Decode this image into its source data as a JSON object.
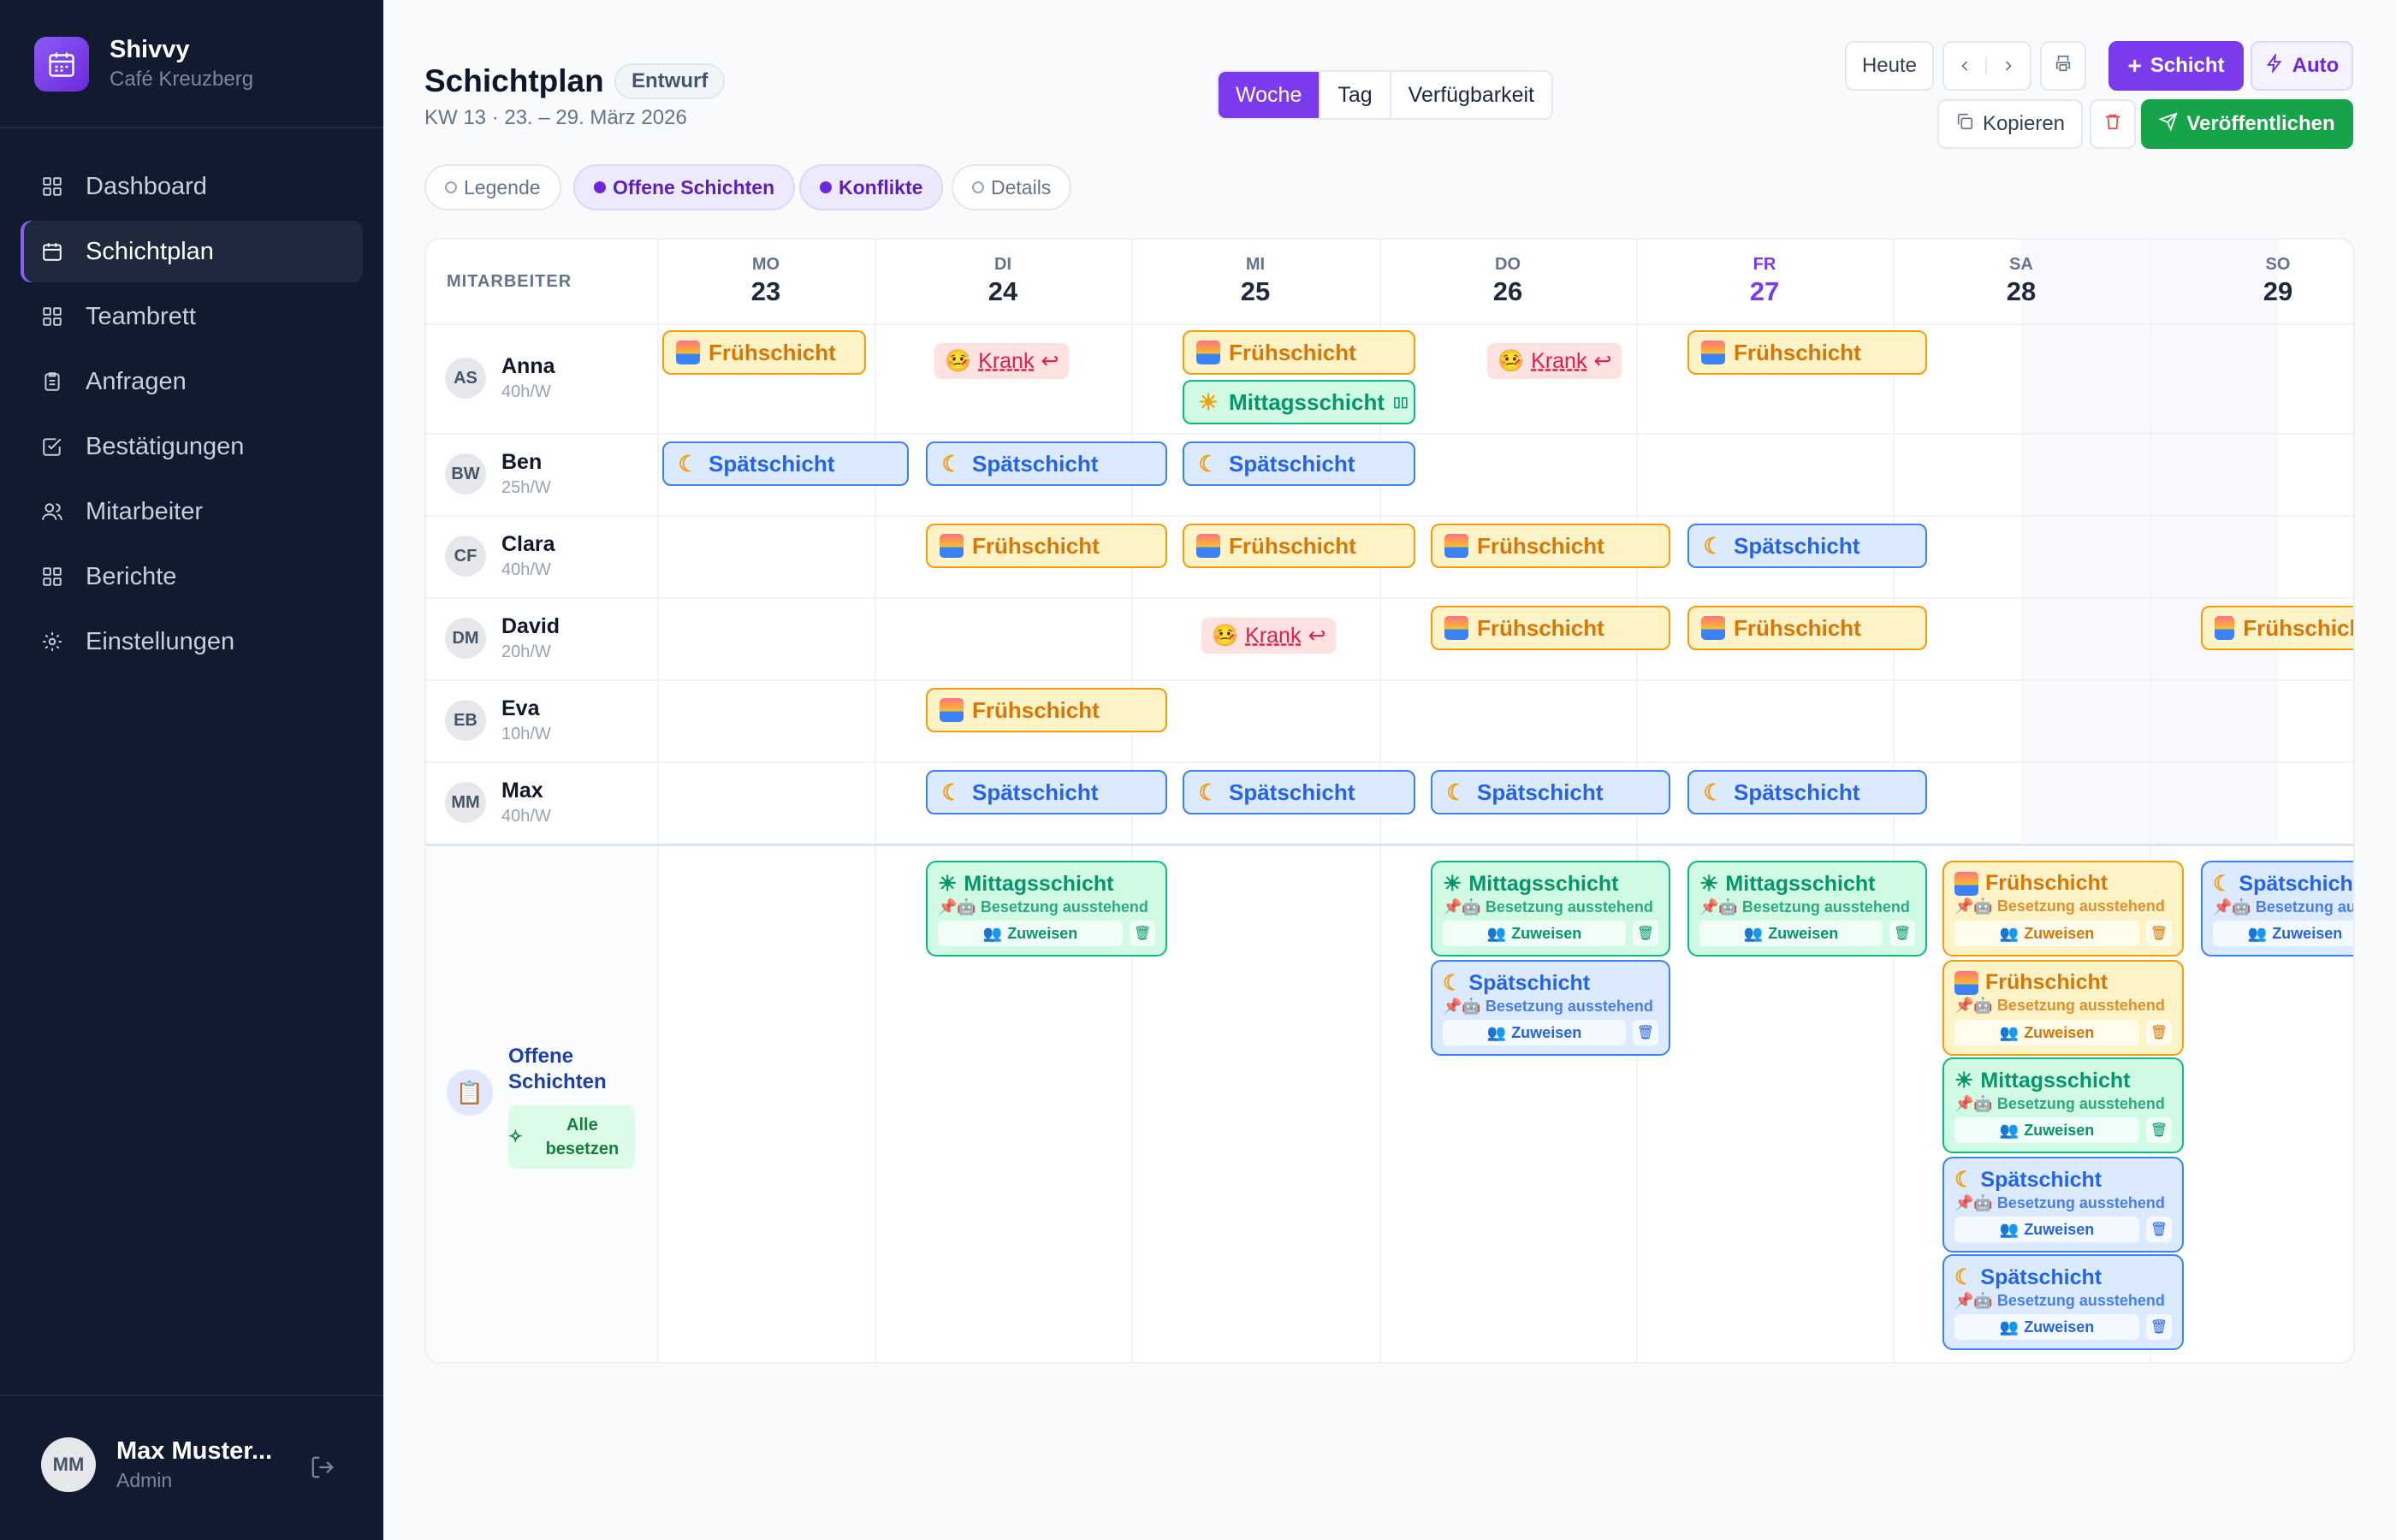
{
  "brand": {
    "name": "Shivvy",
    "subtitle": "Café Kreuzberg"
  },
  "nav": [
    {
      "label": "Dashboard",
      "icon": "grid-icon",
      "active": false
    },
    {
      "label": "Schichtplan",
      "icon": "calendar-icon",
      "active": true
    },
    {
      "label": "Teambrett",
      "icon": "grid-icon",
      "active": false
    },
    {
      "label": "Anfragen",
      "icon": "clipboard-icon",
      "active": false
    },
    {
      "label": "Bestätigungen",
      "icon": "check-square-icon",
      "active": false
    },
    {
      "label": "Mitarbeiter",
      "icon": "users-icon",
      "active": false
    },
    {
      "label": "Berichte",
      "icon": "grid-icon",
      "active": false
    },
    {
      "label": "Einstellungen",
      "icon": "gear-icon",
      "active": false
    }
  ],
  "user": {
    "initials": "MM",
    "name": "Max Muster...",
    "role": "Admin"
  },
  "page": {
    "title": "Schichtplan",
    "status": "Entwurf",
    "subtitle": "KW 13 · 23. – 29. März 2026"
  },
  "views": [
    "Woche",
    "Tag",
    "Verfügbarkeit"
  ],
  "toolbar": {
    "today": "Heute",
    "shift": "Schicht",
    "auto": "Auto",
    "copy": "Kopieren",
    "publish": "Veröffentlichen"
  },
  "filters": [
    {
      "label": "Legende",
      "active": false
    },
    {
      "label": "Offene Schichten",
      "active": true
    },
    {
      "label": "Konflikte",
      "active": true
    },
    {
      "label": "Details",
      "active": false
    }
  ],
  "grid": {
    "header": "MITARBEITER",
    "days": [
      {
        "name": "MO",
        "date": "23"
      },
      {
        "name": "DI",
        "date": "24"
      },
      {
        "name": "MI",
        "date": "25"
      },
      {
        "name": "DO",
        "date": "26"
      },
      {
        "name": "FR",
        "date": "27"
      },
      {
        "name": "SA",
        "date": "28"
      },
      {
        "name": "SO",
        "date": "29"
      }
    ]
  },
  "employees": [
    {
      "initials": "AS",
      "name": "Anna",
      "hours": "40h/W"
    },
    {
      "initials": "BW",
      "name": "Ben",
      "hours": "25h/W"
    },
    {
      "initials": "CF",
      "name": "Clara",
      "hours": "40h/W"
    },
    {
      "initials": "DM",
      "name": "David",
      "hours": "20h/W"
    },
    {
      "initials": "EB",
      "name": "Eva",
      "hours": "10h/W"
    },
    {
      "initials": "MM",
      "name": "Max",
      "hours": "40h/W"
    }
  ],
  "shift_labels": {
    "early": "Frühschicht",
    "late": "Spätschicht",
    "mid": "Mittagsschicht",
    "sick": "Krank"
  },
  "open": {
    "title": "Offene Schichten",
    "fill_all": "Alle besetzen",
    "pending": "Besetzung ausstehend",
    "assign": "Zuweisen"
  },
  "colors": {
    "accent": "#7c3aed",
    "publish": "#16a34a",
    "sidebar": "#111a2e"
  }
}
